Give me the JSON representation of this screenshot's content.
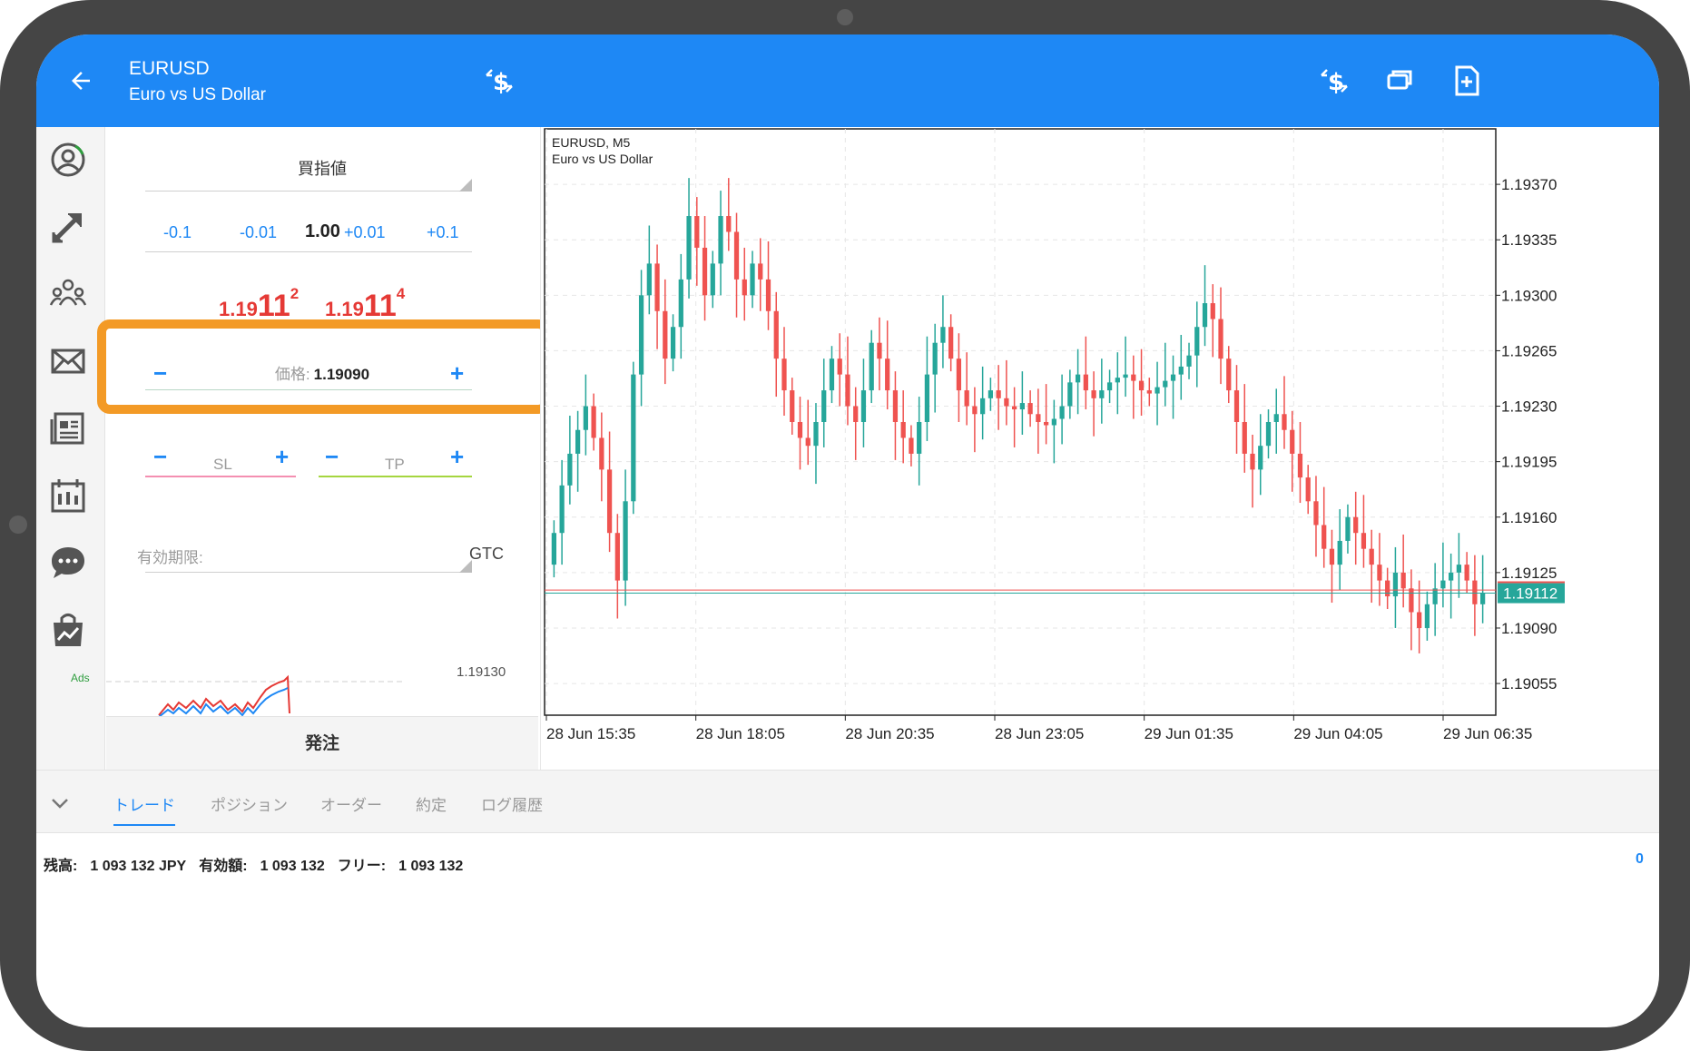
{
  "header": {
    "symbol": "EURUSD",
    "description": "Euro vs US Dollar"
  },
  "nav": {
    "ads_label": "Ads"
  },
  "order": {
    "order_type": "買指値",
    "volume_steps": [
      "-0.1",
      "-0.01",
      "+0.01",
      "+0.1"
    ],
    "volume": "1.00",
    "bid": {
      "prefix": "1.19",
      "big": "11",
      "suffix": "2"
    },
    "ask": {
      "prefix": "1.19",
      "big": "11",
      "suffix": "4"
    },
    "price_label": "価格:",
    "price_value": "1.19090",
    "minus": "−",
    "plus": "+",
    "sl_label": "SL",
    "tp_label": "TP",
    "expiry_label": "有効期限:",
    "expiry_value": "GTC",
    "mini_chart_price": "1.19130",
    "submit_label": "発注"
  },
  "chart_data": {
    "type": "candlestick",
    "title": "EURUSD, M5",
    "subtitle": "Euro vs US Dollar",
    "y_ticks": [
      "1.19370",
      "1.19335",
      "1.19300",
      "1.19265",
      "1.19230",
      "1.19195",
      "1.19160",
      "1.19125",
      "1.19090",
      "1.19055"
    ],
    "ylim": [
      1.19035,
      1.19405
    ],
    "x_ticks": [
      "28 Jun 15:35",
      "28 Jun 18:05",
      "28 Jun 20:35",
      "28 Jun 23:05",
      "29 Jun 01:35",
      "29 Jun 04:05",
      "29 Jun 06:35"
    ],
    "current_price": 1.19112,
    "current_price_label": "1.19112",
    "ask_line": 1.19114,
    "close_series": [
      1.1915,
      1.1918,
      1.192,
      1.19215,
      1.1923,
      1.1921,
      1.1919,
      1.1915,
      1.1912,
      1.1917,
      1.1925,
      1.193,
      1.1932,
      1.1929,
      1.1926,
      1.1928,
      1.1931,
      1.1935,
      1.1933,
      1.193,
      1.1932,
      1.1935,
      1.1934,
      1.1931,
      1.193,
      1.1932,
      1.1931,
      1.1929,
      1.1926,
      1.1924,
      1.1922,
      1.1921,
      1.19205,
      1.1922,
      1.1924,
      1.1926,
      1.1925,
      1.1923,
      1.1922,
      1.1924,
      1.1927,
      1.1926,
      1.1924,
      1.1922,
      1.1921,
      1.192,
      1.1922,
      1.1925,
      1.1927,
      1.1928,
      1.1926,
      1.1924,
      1.1923,
      1.19225,
      1.19235,
      1.1924,
      1.19235,
      1.1923,
      1.19228,
      1.19232,
      1.19225,
      1.1922,
      1.19218,
      1.19222,
      1.1923,
      1.19245,
      1.1925,
      1.1924,
      1.19235,
      1.1924,
      1.19245,
      1.19248,
      1.1925,
      1.19246,
      1.1924,
      1.19238,
      1.19242,
      1.19246,
      1.1925,
      1.19255,
      1.19262,
      1.1928,
      1.19295,
      1.19285,
      1.1926,
      1.1924,
      1.1922,
      1.192,
      1.1919,
      1.19205,
      1.1922,
      1.19225,
      1.19215,
      1.192,
      1.19185,
      1.1917,
      1.19155,
      1.1914,
      1.1913,
      1.19145,
      1.1916,
      1.1915,
      1.1914,
      1.1913,
      1.1912,
      1.1911,
      1.19125,
      1.19115,
      1.191,
      1.1909,
      1.19105,
      1.19115,
      1.1912,
      1.19125,
      1.1913,
      1.1912,
      1.19105,
      1.19112
    ]
  },
  "bottom": {
    "tabs": [
      "トレード",
      "ポジション",
      "オーダー",
      "約定",
      "ログ履歴"
    ],
    "active_tab": "トレード",
    "balance_label": "残高:",
    "balance_value": "1 093 132 JPY",
    "equity_label": "有効額:",
    "equity_value": "1 093 132",
    "free_label": "フリー:",
    "free_value": "1 093 132",
    "count": "0"
  },
  "colors": {
    "appbar": "#1e88f5",
    "highlight": "#f39a26",
    "bull": "#26a69a",
    "bear": "#ef5350",
    "sl_line": "#f48fb1",
    "tp_line": "#a5d63f"
  }
}
